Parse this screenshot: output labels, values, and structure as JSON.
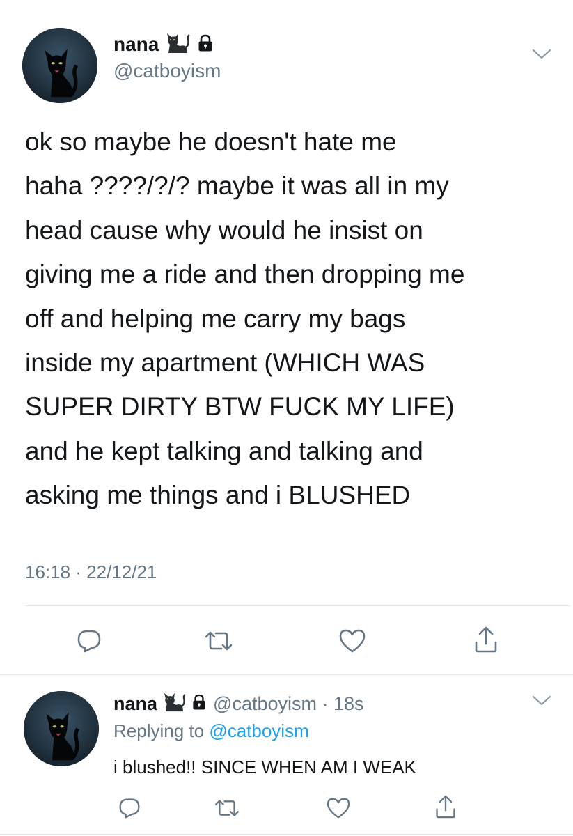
{
  "main_tweet": {
    "display_name": "nana",
    "name_emoji": "🐈‍⬛",
    "lock_icon": "lock-icon",
    "handle": "@catboyism",
    "text_lines": [
      "ok so maybe he doesn't hate me",
      "haha ????/?/? maybe it was all in my",
      "head cause why would he insist on",
      "giving me a ride and then dropping me",
      "off and helping me carry my bags",
      "inside my apartment (WHICH WAS",
      "SUPER DIRTY BTW FUCK MY LIFE)",
      "and he kept talking and talking and",
      "asking me things and i BLUSHED"
    ],
    "timestamp": "16:18 · 22/12/21",
    "actions": [
      "reply-icon",
      "retweet-icon",
      "like-icon",
      "share-icon"
    ]
  },
  "reply_tweet": {
    "display_name": "nana",
    "name_emoji": "🐈‍⬛",
    "handle_time": "@catboyism · 18s",
    "replying_prefix": "Replying to",
    "replying_to": "@catboyism",
    "text": "i blushed!!  SINCE WHEN AM I WEAK",
    "actions": [
      "reply-icon",
      "retweet-icon",
      "like-icon",
      "share-icon"
    ]
  },
  "colors": {
    "text": "#14171a",
    "secondary": "#657786",
    "link": "#1da1f2",
    "divider": "#e1e8ed",
    "icon": "#657786"
  }
}
